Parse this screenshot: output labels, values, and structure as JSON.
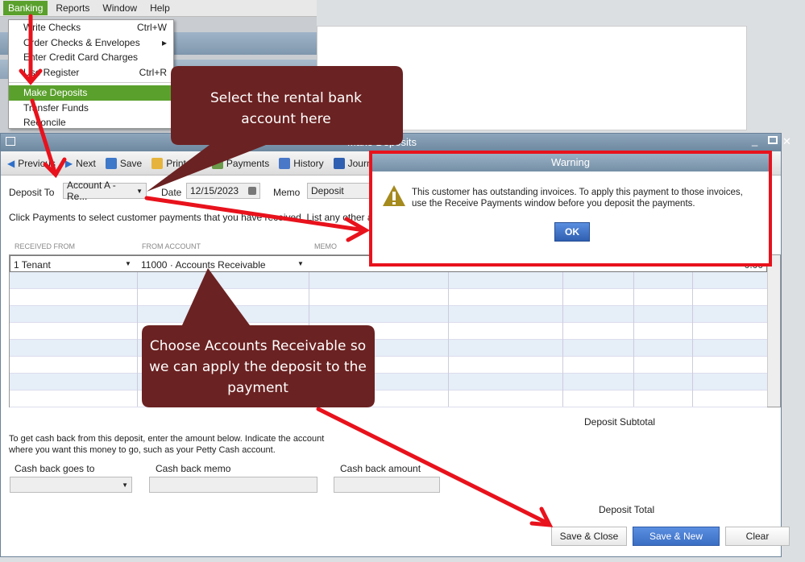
{
  "menubar": {
    "items": [
      "Banking",
      "Reports",
      "Window",
      "Help"
    ]
  },
  "banking_menu": [
    {
      "label": "Write Checks",
      "shortcut": "Ctrl+W"
    },
    {
      "label": "Order Checks & Envelopes",
      "shortcut": "▸"
    },
    {
      "label": "Enter Credit Card Charges",
      "shortcut": ""
    },
    {
      "label": "Use Register",
      "shortcut": "Ctrl+R"
    },
    {
      "label": "Make Deposits",
      "shortcut": ""
    },
    {
      "label": "Transfer Funds",
      "shortcut": ""
    },
    {
      "label": "Reconcile",
      "shortcut": ""
    }
  ],
  "window": {
    "title": "Make Deposits"
  },
  "toolbar": {
    "previous": "Previous",
    "next": "Next",
    "save": "Save",
    "print": "Print",
    "payments": "Payments",
    "history": "History",
    "journal": "Journal"
  },
  "form": {
    "deposit_to_label": "Deposit To",
    "deposit_to_value": "Account A - Re...",
    "date_label": "Date",
    "date_value": "12/15/2023",
    "memo_label": "Memo",
    "memo_value": "Deposit",
    "instructions": "Click Payments to select customer payments that you have received. List any other amou"
  },
  "grid": {
    "headers": [
      "RECEIVED FROM",
      "FROM ACCOUNT",
      "MEMO"
    ],
    "row1": {
      "received_from": "1 Tenant",
      "from_account": "11000 · Accounts Receivable",
      "amount": "0.00"
    }
  },
  "footer": {
    "subtotal_label": "Deposit Subtotal",
    "cashback_text1": "To get cash back from this deposit, enter the amount below.  Indicate the account",
    "cashback_text2": "where you want this money to go, such as your Petty Cash account.",
    "cashback_to": "Cash back goes to",
    "cashback_memo": "Cash back memo",
    "cashback_amount": "Cash back amount",
    "total_label": "Deposit Total",
    "save_close": "Save & Close",
    "save_new": "Save & New",
    "clear": "Clear"
  },
  "warning": {
    "title": "Warning",
    "line1": "This customer has outstanding invoices.  To apply this payment to those invoices,",
    "line2": "use the Receive Payments window before you deposit the payments.",
    "ok": "OK"
  },
  "callouts": {
    "top": "Select the rental bank account here",
    "bottom": "Choose Accounts Receivable so we can apply the deposit to the payment"
  },
  "colors": {
    "highlight": "#5aa02c",
    "annotation_red": "#e8121c",
    "callout": "#6b2222",
    "primary_button": "#3b6fc4"
  }
}
